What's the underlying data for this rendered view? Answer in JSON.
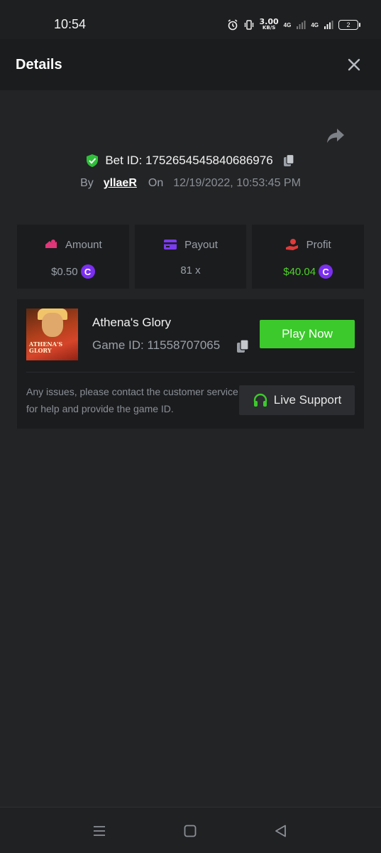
{
  "status_bar": {
    "time": "10:54",
    "net_speed": "3.00",
    "net_unit": "KB/S",
    "net_type_1": "4G",
    "net_type_2": "4G",
    "battery": "2",
    "icons": [
      "alarm-icon",
      "vibrate-icon",
      "signal-icon",
      "signal-icon",
      "battery-icon"
    ]
  },
  "header": {
    "title": "Details",
    "close_icon": "close-icon"
  },
  "bet": {
    "id_label": "Bet ID: 1752654545840686976",
    "by_label": "By",
    "user": "yllaeR",
    "on_label": "On",
    "datetime": "12/19/2022, 10:53:45 PM"
  },
  "stats": {
    "amount_label": "Amount",
    "amount_value": "$0.50",
    "payout_label": "Payout",
    "payout_value": "81 x",
    "profit_label": "Profit",
    "profit_value": "$40.04",
    "coin_symbol": "C"
  },
  "game": {
    "thumbnail_text_1": "ATHENA'S",
    "thumbnail_text_2": "GLORY",
    "name": "Athena's Glory",
    "id_label": "Game ID: 11558707065",
    "play_label": "Play Now",
    "notice": "Any issues, please contact the customer service for help and provide the game ID.",
    "support_label": "Live Support"
  },
  "colors": {
    "background": "#232426",
    "card": "#1b1c1e",
    "accent_green": "#3cc92c",
    "profit_green": "#4fd12a",
    "coin_purple": "#7b2ff0",
    "amount_pink": "#e0367a",
    "payout_purple": "#7b3cf0",
    "profit_red": "#e03a3a"
  }
}
